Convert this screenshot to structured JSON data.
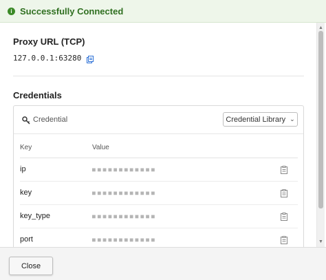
{
  "banner": {
    "icon": "info-icon",
    "text": "Successfully Connected",
    "color": "#2f6f20"
  },
  "proxy": {
    "title": "Proxy URL (TCP)",
    "value": "127.0.0.1:63280",
    "copy_icon": "copy-icon"
  },
  "credentials": {
    "title": "Credentials",
    "panel_icon": "key-icon",
    "panel_label": "Credential",
    "library_button": "Credential Library",
    "columns": {
      "key": "Key",
      "value": "Value"
    },
    "rows": [
      {
        "key": "ip",
        "value_masked": "■■■■■■■■■■■■"
      },
      {
        "key": "key",
        "value_masked": "■■■■■■■■■■■■"
      },
      {
        "key": "key_type",
        "value_masked": "■■■■■■■■■■■■"
      },
      {
        "key": "port",
        "value_masked": "■■■■■■■■■■■■"
      }
    ]
  },
  "footer": {
    "close_label": "Close"
  }
}
